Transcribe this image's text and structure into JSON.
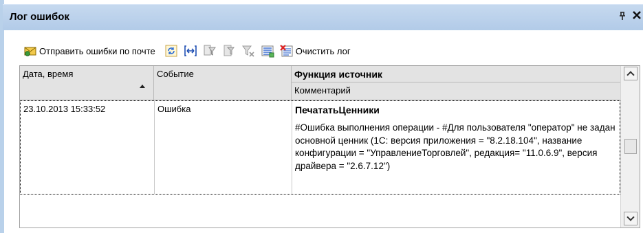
{
  "window": {
    "title": "Лог ошибок",
    "pin_glyph": "ᵖ",
    "close_glyph": "✕"
  },
  "toolbar": {
    "send_errors_label": "Отправить ошибки по почте",
    "clear_log_label": "Очистить лог",
    "icons": [
      "envelope-icon",
      "refresh-icon",
      "arrows-lr-icon",
      "filter-icon",
      "filter-clear-icon",
      "filter-off-icon",
      "list-icon",
      "clear-log-icon"
    ]
  },
  "table": {
    "columns": {
      "date": "Дата, время",
      "event": "Событие",
      "source_func": "Функция источник",
      "comment": "Комментарий"
    },
    "rows": [
      {
        "date": "23.10.2013 15:33:52",
        "event": "Ошибка",
        "source_func": "ПечататьЦенники",
        "comment": "#Ошибка выполнения операции - #Для пользователя \"оператор\" не задан основной ценник (1С: версия приложения = \"8.2.18.104\", название конфигурации = \"УправлениеТорговлей\", редакция= \"11.0.6.9\", версия драйвера = \"2.6.7.12\")"
      }
    ]
  },
  "colors": {
    "title_bar": "#b9d1ea",
    "header_bg": "#e3e3e3"
  }
}
